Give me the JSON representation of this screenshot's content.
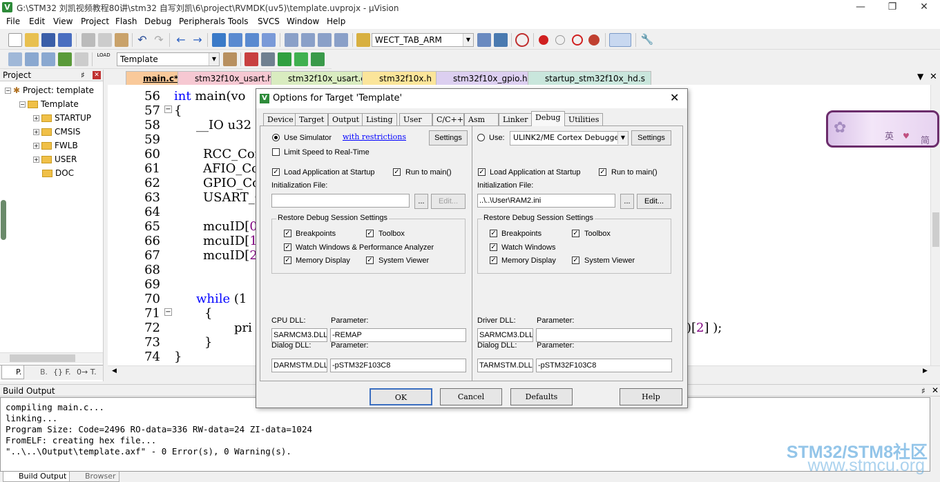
{
  "window": {
    "title": "G:\\STM32 刘凯视频教程80讲\\stm32 自写刘凯\\6\\project\\RVMDK(uv5)\\template.uvprojx - µVision"
  },
  "menu": [
    "File",
    "Edit",
    "View",
    "Project",
    "Flash",
    "Debug",
    "Peripherals",
    "Tools",
    "SVCS",
    "Window",
    "Help"
  ],
  "toolbar": {
    "find_combo": "WECT_TAB_ARM",
    "target_combo": "Template"
  },
  "project_panel": {
    "title": "Project",
    "root": "Project: template",
    "target": "Template",
    "groups": [
      "STARTUP",
      "CMSIS",
      "FWLB",
      "USER",
      "DOC"
    ],
    "tabs": [
      "P.",
      "B.",
      "{} F.",
      "0→ T."
    ]
  },
  "file_tabs": [
    "main.c*",
    "stm32f10x_usart.h",
    "stm32f10x_usart.c",
    "stm32f10x.h",
    "stm32f10x_gpio.h",
    "startup_stm32f10x_hd.s"
  ],
  "code": {
    "line_numbers": [
      "56",
      "57",
      "58",
      "59",
      "60",
      "61",
      "62",
      "63",
      "64",
      "65",
      "66",
      "67",
      "68",
      "69",
      "70",
      "71",
      "72",
      "73",
      "74"
    ],
    "l56a": "int",
    "l56b": " main(vo",
    "l57": "{",
    "l58": "__IO u32",
    "l60": "RCC_Con",
    "l61": "AFIO_Co",
    "l62": "GPIO_Co",
    "l63": "USART_C",
    "l65a": "mcuID[",
    "l65b": "0",
    "l66a": "mcuID[",
    "l66b": "1",
    "l67a": "mcuID[",
    "l67b": "2",
    "l70a": "while",
    "l70b": " (1",
    "l71": "{",
    "l72a": "pri",
    "l72b": ")[",
    "l72c": "2",
    "l72d": "] );",
    "l73": "}",
    "l74": "}"
  },
  "build": {
    "title": "Build Output",
    "lines": [
      "compiling main.c...",
      "linking...",
      "Program Size: Code=2496 RO-data=336 RW-data=24 ZI-data=1024",
      "FromELF: creating hex file...",
      "\"..\\..\\Output\\template.axf\" - 0 Error(s), 0 Warning(s)."
    ],
    "tabs": [
      "Build Output",
      "Browser"
    ]
  },
  "watermark": {
    "line1": "STM32/STM8社区",
    "line2": "www.stmcu.org"
  },
  "ime": {
    "c1": "英",
    "c2": "简"
  },
  "dialog": {
    "title": "Options for Target 'Template'",
    "close": "✕",
    "tabs": [
      "Device",
      "Target",
      "Output",
      "Listing",
      "User",
      "C/C++",
      "Asm",
      "Linker",
      "Debug",
      "Utilities"
    ],
    "left": {
      "use_simulator": "Use Simulator",
      "with_restrictions": "with restrictions",
      "settings": "Settings",
      "limit_speed": "Limit Speed to Real-Time",
      "load_app": "Load Application at Startup",
      "run_to_main": "Run to main()",
      "init_file_label": "Initialization File:",
      "init_file_value": "",
      "browse": "...",
      "edit": "Edit...",
      "restore_group": "Restore Debug Session Settings",
      "breakpoints": "Breakpoints",
      "toolbox": "Toolbox",
      "watch": "Watch Windows & Performance Analyzer",
      "memory": "Memory Display",
      "system_viewer": "System Viewer",
      "dll_label": "CPU DLL:",
      "param_label": "Parameter:",
      "dll_value": "SARMCM3.DLL",
      "param_value": "-REMAP",
      "dialog_dll_label": "Dialog DLL:",
      "dialog_param_label": "Parameter:",
      "dialog_dll_value": "DARMSTM.DLL",
      "dialog_param_value": "-pSTM32F103C8"
    },
    "right": {
      "use": "Use:",
      "debugger": "ULINK2/ME Cortex Debugger",
      "settings": "Settings",
      "load_app": "Load Application at Startup",
      "run_to_main": "Run to main()",
      "init_file_label": "Initialization File:",
      "init_file_value": "..\\..\\User\\RAM2.ini",
      "browse": "...",
      "edit": "Edit...",
      "restore_group": "Restore Debug Session Settings",
      "breakpoints": "Breakpoints",
      "toolbox": "Toolbox",
      "watch": "Watch Windows",
      "memory": "Memory Display",
      "system_viewer": "System Viewer",
      "dll_label": "Driver DLL:",
      "param_label": "Parameter:",
      "dll_value": "SARMCM3.DLL",
      "param_value": "",
      "dialog_dll_label": "Dialog DLL:",
      "dialog_param_label": "Parameter:",
      "dialog_dll_value": "TARMSTM.DLL",
      "dialog_param_value": "-pSTM32F103C8"
    },
    "buttons": {
      "ok": "OK",
      "cancel": "Cancel",
      "defaults": "Defaults",
      "help": "Help"
    }
  }
}
